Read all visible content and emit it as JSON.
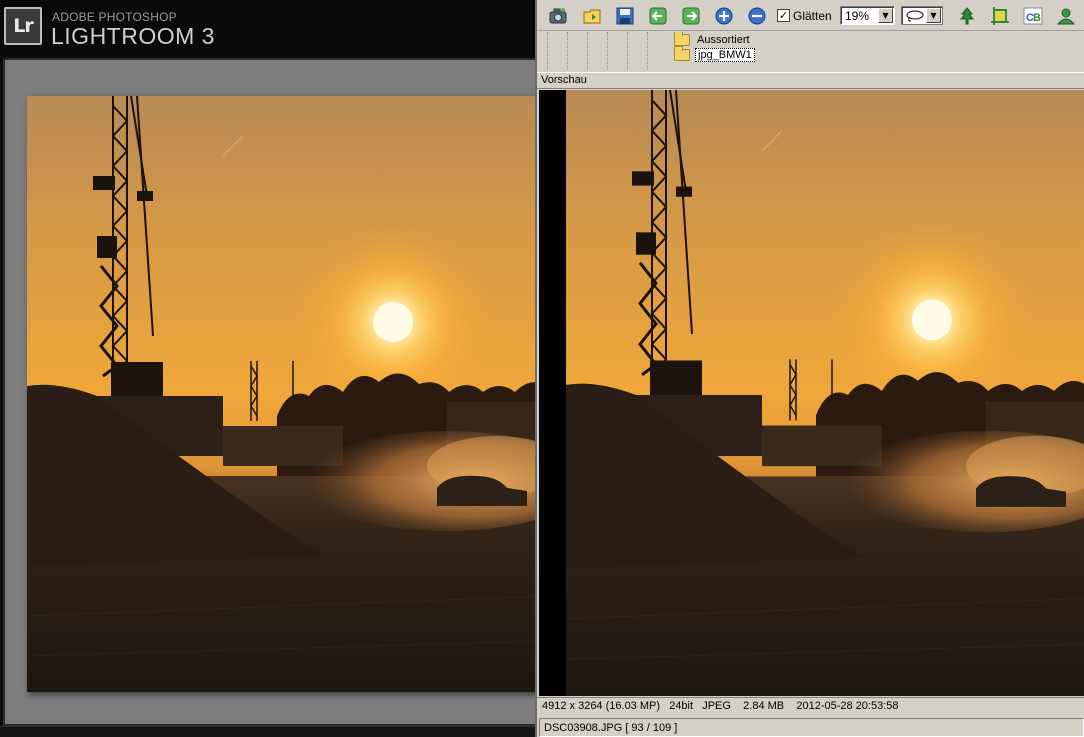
{
  "lightroom": {
    "logo": "Lr",
    "brand_top": "ADOBE PHOTOSHOP",
    "brand_main": "LIGHTROOM 3"
  },
  "viewer": {
    "toolbar": {
      "smooth_label": "Glätten",
      "smooth_checked": true,
      "zoom_value": "19%",
      "icons": [
        "camera-icon",
        "open-folder-icon",
        "save-icon",
        "back-arrow-icon",
        "forward-arrow-icon",
        "zoom-in-icon",
        "zoom-out-icon",
        "lasso-icon",
        "tree-icon",
        "crop-icon",
        "color-balance-icon",
        "user-icon"
      ]
    },
    "tree": {
      "items": [
        {
          "label": "Aussortiert",
          "selected": false
        },
        {
          "label": "jpg_BMW1",
          "selected": true
        }
      ]
    },
    "preview_title": "Vorschau",
    "status_info": "4912 x 3264 (16.03 MP)   24bit   JPEG    2.84 MB    2012-05-28 20:53:58",
    "status_file": "DSC03908.JPG [ 93 / 109 ]"
  },
  "colors": {
    "sky_top": "#c08a4a",
    "sky_mid": "#f1a52a",
    "sun": "#fff6c0",
    "ground": "#2a1e14",
    "win_face": "#d4d0c8"
  }
}
